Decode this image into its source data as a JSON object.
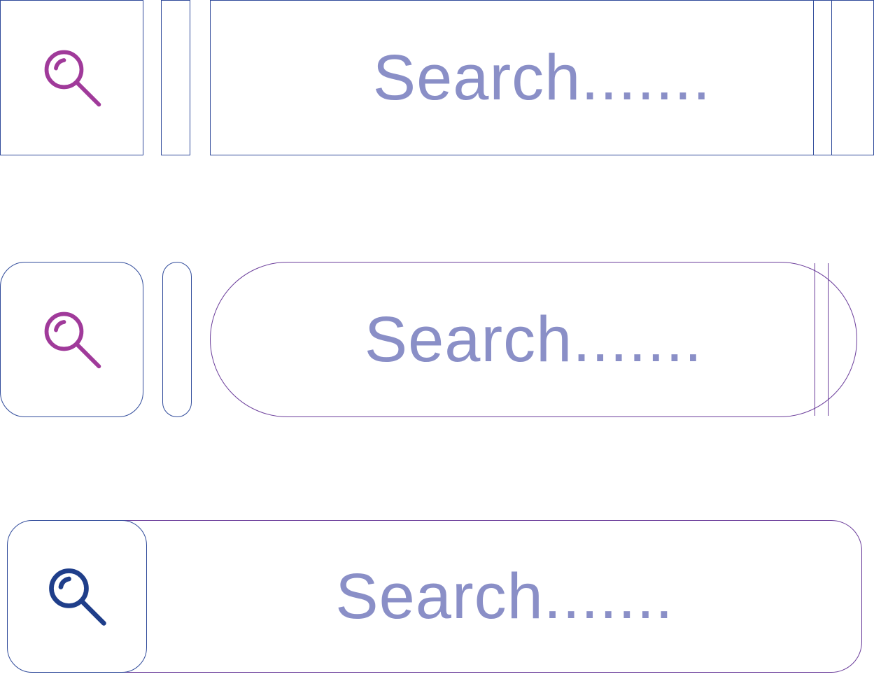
{
  "search_rows": [
    {
      "placeholder": "Search.......",
      "icon_color": "#a03a9a"
    },
    {
      "placeholder": "Search.......",
      "icon_color": "#a03a9a"
    },
    {
      "placeholder": "Search.......",
      "icon_color": "#1f3e8a"
    }
  ]
}
